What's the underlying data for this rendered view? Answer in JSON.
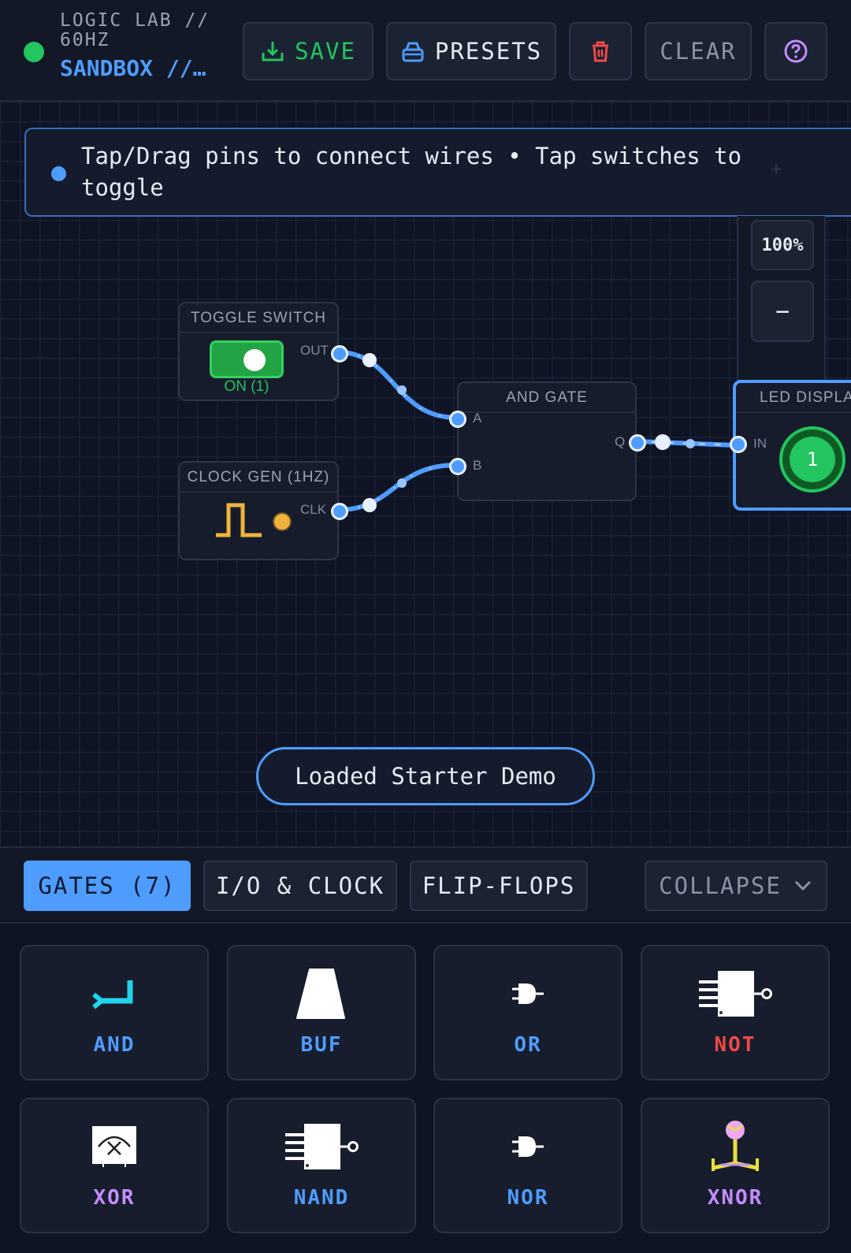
{
  "header": {
    "app_title": "LOGIC LAB // 60HZ",
    "subtitle": "SANDBOX //…",
    "save_label": "SAVE",
    "presets_label": "PRESETS",
    "clear_label": "CLEAR",
    "status_color": "#22c55e",
    "accent": "#4f9cff",
    "icons": {
      "save": "download-tray-icon",
      "presets": "stack-icon",
      "delete": "trash-icon",
      "help": "help-circle-icon"
    }
  },
  "canvas": {
    "hint": "Tap/Drag pins to connect wires • Tap switches to toggle",
    "hint_plus": "+",
    "zoom": {
      "value": "100%",
      "minus": "−"
    },
    "nodes": {
      "toggle": {
        "title": "TOGGLE SWITCH",
        "out_label": "OUT",
        "state": "ON (1)"
      },
      "clock": {
        "title": "CLOCK GEN (1HZ)",
        "clk_label": "CLK"
      },
      "and": {
        "title": "AND GATE",
        "a_label": "A",
        "b_label": "B",
        "q_label": "Q"
      },
      "led": {
        "title": "LED DISPLAY",
        "in_label": "IN",
        "value": "1"
      }
    },
    "wire_color": "#4f9cff",
    "toast": "Loaded Starter Demo"
  },
  "tabs": {
    "gates": "GATES (7)",
    "io": "I/O & CLOCK",
    "flipflops": "FLIP-FLOPS",
    "collapse": "COLLAPSE"
  },
  "palette": [
    {
      "label": "AND",
      "icon": "and-gate-icon",
      "color": "#4f9cff"
    },
    {
      "label": "BUF",
      "icon": "buffer-gate-icon",
      "color": "#4f9cff"
    },
    {
      "label": "OR",
      "icon": "or-gate-icon",
      "color": "#4f9cff"
    },
    {
      "label": "NOT",
      "icon": "not-gate-icon",
      "color": "#f04848"
    },
    {
      "label": "XOR",
      "icon": "xor-gate-icon",
      "color": "#c48cff"
    },
    {
      "label": "NAND",
      "icon": "nand-gate-icon",
      "color": "#4f9cff"
    },
    {
      "label": "NOR",
      "icon": "nor-gate-icon",
      "color": "#4f9cff"
    },
    {
      "label": "XNOR",
      "icon": "xnor-gate-icon",
      "color": "#c48cff"
    }
  ]
}
